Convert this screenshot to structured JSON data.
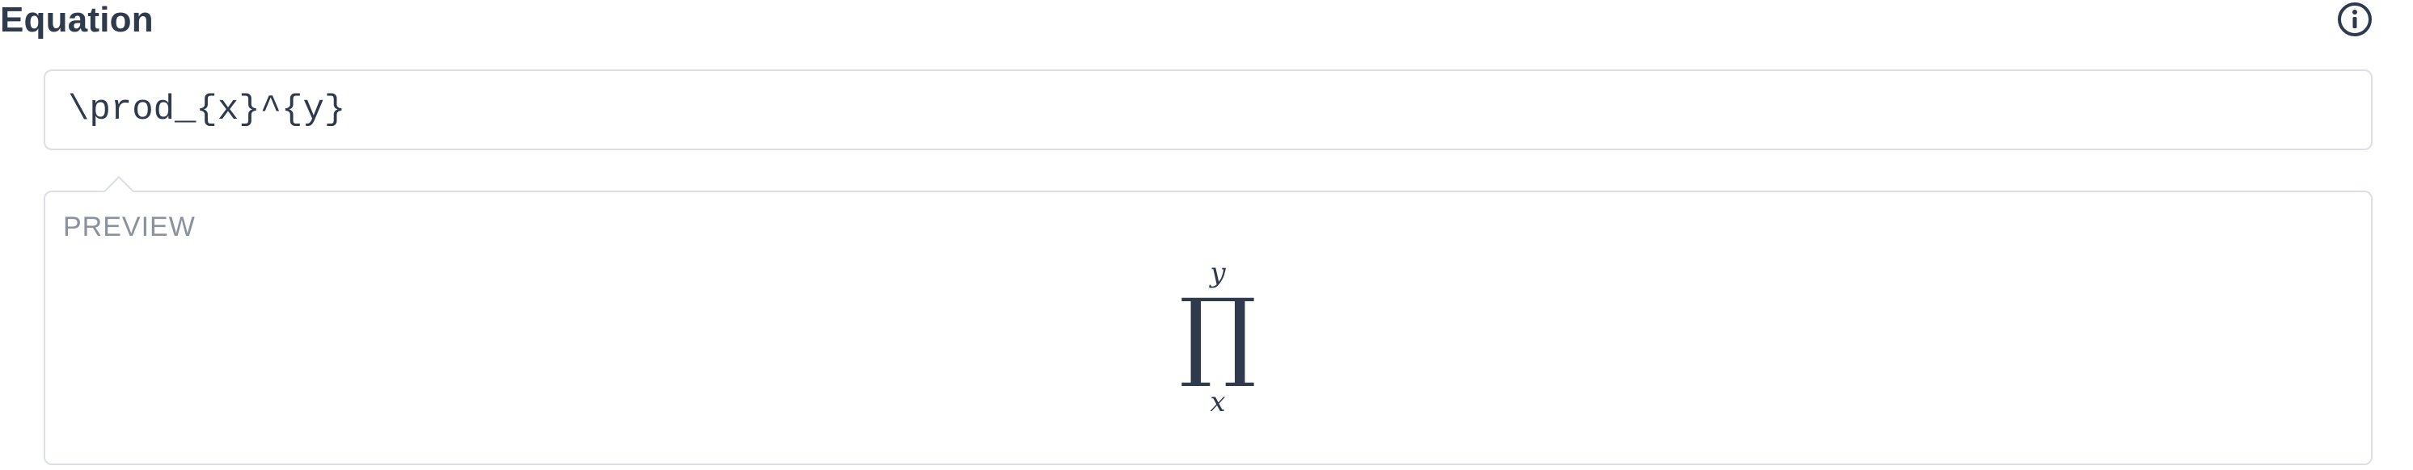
{
  "header": {
    "title": "Equation",
    "info_icon": "info-circle-icon"
  },
  "equation": {
    "value": "\\prod_{x}^{y}"
  },
  "preview": {
    "label": "PREVIEW",
    "operator": "∏",
    "superscript": "y",
    "subscript": "x"
  },
  "colors": {
    "text": "#2f3b4c",
    "muted": "#8a929d",
    "border": "#dcdfe4"
  }
}
